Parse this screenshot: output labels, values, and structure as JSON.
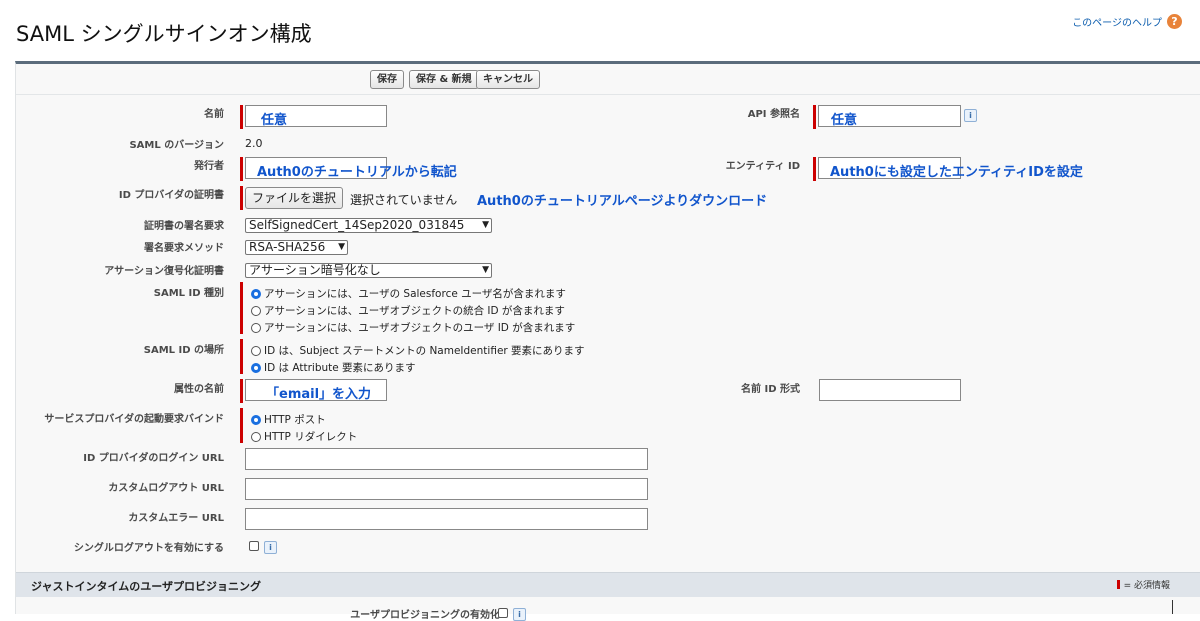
{
  "header": {
    "title": "SAML シングルサインオン構成",
    "help_link": "このページのヘルプ",
    "help_icon": "?"
  },
  "toolbar": {
    "save_label": "保存",
    "save_new_label": "保存 & 新規",
    "cancel_label": "キャンセル"
  },
  "form": {
    "name": {
      "label": "名前",
      "annotation": "任意"
    },
    "api_name": {
      "label": "API 参照名",
      "annotation": "任意"
    },
    "saml_version": {
      "label": "SAML のバージョン",
      "value": "2.0"
    },
    "issuer": {
      "label": "発行者",
      "annotation": "Auth0のチュートリアルから転記"
    },
    "entity_id": {
      "label": "エンティティ ID",
      "annotation": "Auth0にも設定したエンティティIDを設定"
    },
    "idp_cert": {
      "label": "ID プロバイダの証明書",
      "file_button": "ファイルを選択",
      "file_status": "選択されていません",
      "annotation": "Auth0のチュートリアルページよりダウンロード"
    },
    "request_signing_cert": {
      "label": "証明書の署名要求",
      "selected": "SelfSignedCert_14Sep2020_031845"
    },
    "request_signature_method": {
      "label": "署名要求メソッド",
      "selected": "RSA-SHA256"
    },
    "assertion_decryption_cert": {
      "label": "アサーション復号化証明書",
      "selected": "アサーション暗号化なし"
    },
    "saml_id_type": {
      "label": "SAML ID 種別",
      "options": [
        "アサーションには、ユーザの Salesforce ユーザ名が含まれます",
        "アサーションには、ユーザオブジェクトの統合 ID が含まれます",
        "アサーションには、ユーザオブジェクトのユーザ ID が含まれます"
      ]
    },
    "saml_id_location": {
      "label": "SAML ID の場所",
      "options": [
        "ID は、Subject ステートメントの NameIdentifier 要素にあります",
        "ID は Attribute 要素にあります"
      ]
    },
    "attribute_name": {
      "label": "属性の名前",
      "annotation": "「email」を入力"
    },
    "name_id_format": {
      "label": "名前 ID 形式"
    },
    "sp_binding": {
      "label": "サービスプロバイダの起動要求バインド",
      "options": [
        "HTTP ポスト",
        "HTTP リダイレクト"
      ]
    },
    "idp_login_url": {
      "label": "ID プロバイダのログイン URL"
    },
    "custom_logout_url": {
      "label": "カスタムログアウト URL"
    },
    "custom_error_url": {
      "label": "カスタムエラー URL"
    },
    "single_logout": {
      "label": "シングルログアウトを有効にする"
    }
  },
  "jit_section": {
    "title": "ジャストインタイムのユーザプロビジョニング",
    "legend": "= 必須情報",
    "enable_label": "ユーザプロビジョニングの有効化"
  },
  "icons": {
    "info": "i"
  },
  "colors": {
    "required": "#cc0000",
    "annotation": "#1155cc",
    "panel_border": "#5b6c7c"
  }
}
